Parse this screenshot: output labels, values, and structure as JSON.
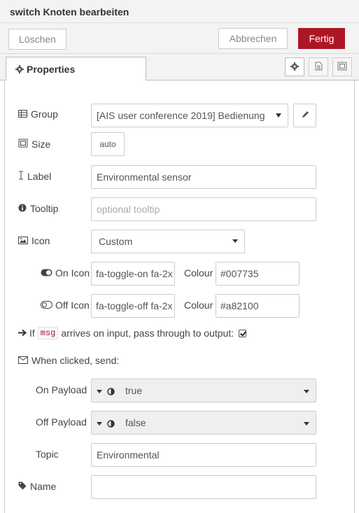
{
  "header": {
    "title": "switch Knoten bearbeiten",
    "delete_label": "Löschen",
    "cancel_label": "Abbrechen",
    "done_label": "Fertig",
    "accent": "#ad1625"
  },
  "tabs": {
    "properties_label": "Properties"
  },
  "form": {
    "group": {
      "label": "Group",
      "value": "[AIS user conference 2019] Bedienung"
    },
    "size": {
      "label": "Size",
      "value": "auto"
    },
    "label": {
      "label": "Label",
      "value": "Environmental sensor"
    },
    "tooltip": {
      "label": "Tooltip",
      "placeholder": "optional tooltip"
    },
    "icon": {
      "label": "Icon",
      "value": "Custom"
    },
    "on_icon": {
      "label": "On Icon",
      "value": "fa-toggle-on fa-2x",
      "colour_label": "Colour",
      "colour": "#007735"
    },
    "off_icon": {
      "label": "Off Icon",
      "value": "fa-toggle-off fa-2x",
      "colour_label": "Colour",
      "colour": "#a82100"
    },
    "passthrough": {
      "prefix": "If",
      "code": "msg",
      "suffix": "arrives on input, pass through to output:",
      "checked": true
    },
    "when_clicked": {
      "label": "When clicked, send:"
    },
    "on_payload": {
      "label": "On Payload",
      "value": "true"
    },
    "off_payload": {
      "label": "Off Payload",
      "value": "false"
    },
    "topic": {
      "label": "Topic",
      "value": "Environmental"
    },
    "name": {
      "label": "Name",
      "value": ""
    }
  }
}
